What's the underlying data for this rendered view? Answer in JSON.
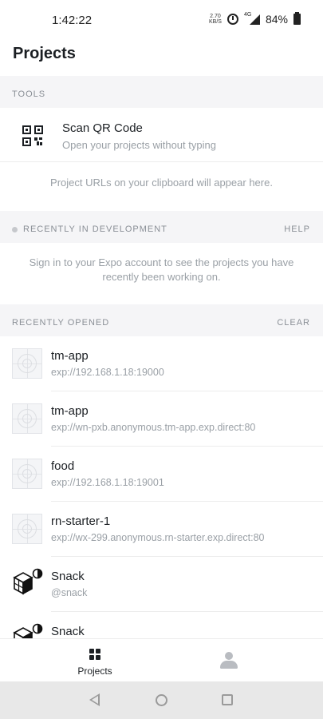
{
  "status_bar": {
    "time": "1:42:22",
    "net_speed_value": "2.70",
    "net_speed_unit": "KB/S",
    "network_type": "4G",
    "battery": "84%",
    "icons": [
      "alarm-icon",
      "signal-icon",
      "battery-icon"
    ]
  },
  "page": {
    "title": "Projects"
  },
  "tools": {
    "header": "TOOLS",
    "scan": {
      "title": "Scan QR Code",
      "subtitle": "Open your projects without typing",
      "icon": "qr-code-icon"
    },
    "clipboard_note": "Project URLs on your clipboard will appear here."
  },
  "development": {
    "header": "RECENTLY IN DEVELOPMENT",
    "action": "HELP",
    "note": "Sign in to your Expo account to see the projects you have recently been working on."
  },
  "recent": {
    "header": "RECENTLY OPENED",
    "action": "CLEAR",
    "items": [
      {
        "name": "tm-app",
        "url": "exp://192.168.1.18:19000",
        "icon": "project-placeholder-icon"
      },
      {
        "name": "tm-app",
        "url": "exp://wn-pxb.anonymous.tm-app.exp.direct:80",
        "icon": "project-placeholder-icon"
      },
      {
        "name": "food",
        "url": "exp://192.168.1.18:19001",
        "icon": "project-placeholder-icon"
      },
      {
        "name": "rn-starter-1",
        "url": "exp://wx-299.anonymous.rn-starter.exp.direct:80",
        "icon": "project-placeholder-icon"
      },
      {
        "name": "Snack",
        "url": "@snack",
        "icon": "snack-icon"
      },
      {
        "name": "Snack",
        "url": "",
        "icon": "snack-icon"
      }
    ]
  },
  "tab_bar": {
    "projects_label": "Projects",
    "projects_icon": "grid-icon",
    "profile_icon": "person-icon"
  },
  "nav_bar": {
    "icons": [
      "back-icon",
      "home-icon",
      "recents-icon"
    ]
  }
}
